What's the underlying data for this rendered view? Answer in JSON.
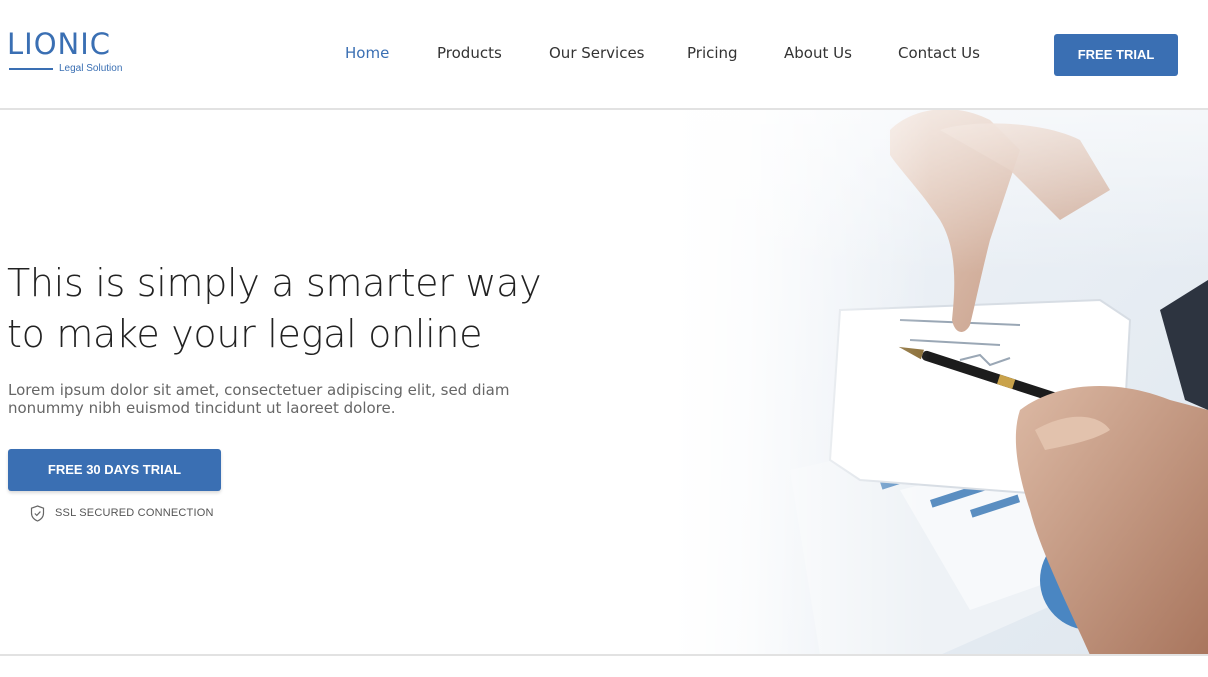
{
  "brand": {
    "name": "LIONIC",
    "tagline": "Legal Solution",
    "color": "#3a6fb3"
  },
  "nav": {
    "items": [
      {
        "label": "Home",
        "active": true
      },
      {
        "label": "Products",
        "active": false
      },
      {
        "label": "Our Services",
        "active": false
      },
      {
        "label": "Pricing",
        "active": false
      },
      {
        "label": "About Us",
        "active": false
      },
      {
        "label": "Contact Us",
        "active": false
      }
    ],
    "cta_label": "FREE TRIAL"
  },
  "hero": {
    "headline_line1": "This is simply a smarter way",
    "headline_line2": "to make your legal online",
    "subtext": "Lorem ipsum dolor sit amet, consectetuer adipiscing elit, sed diam nonummy nibh euismod tincidunt ut laoreet dolore.",
    "cta_label": "FREE 30 DAYS TRIAL",
    "security_label": "SSL SECURED CONNECTION",
    "security_icon": "shield-check-icon",
    "image": "hands-pointing-at-tablet-with-pen-and-charts"
  }
}
